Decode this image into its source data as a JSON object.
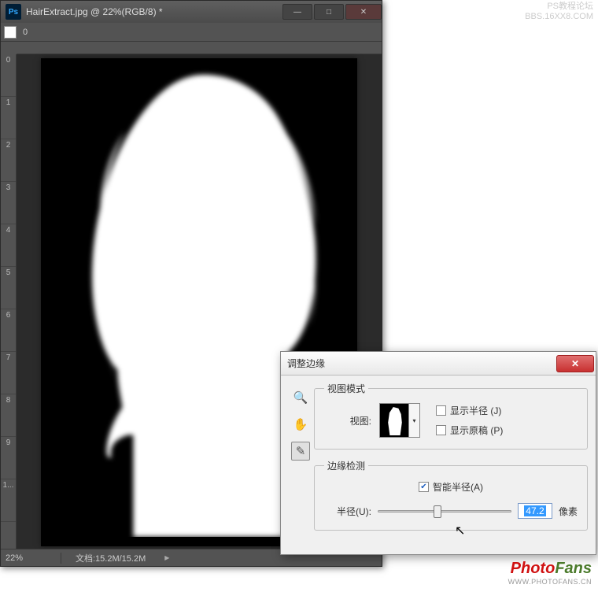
{
  "window": {
    "title": "HairExtract.jpg @ 22%(RGB/8) *",
    "toolbar_opacity": "0",
    "ruler_marks": [
      "0",
      "1",
      "2",
      "3",
      "4",
      "5",
      "6",
      "7",
      "8",
      "9",
      "1..."
    ]
  },
  "statusbar": {
    "zoom": "22%",
    "doc_label": "文档:15.2M/15.2M"
  },
  "dialog": {
    "title": "调整边缘",
    "groups": {
      "view_mode": "视图模式",
      "edge_detect": "边缘检测"
    },
    "view_label": "视图:",
    "show_radius": "显示半径 (J)",
    "show_original": "显示原稿 (P)",
    "smart_radius": "智能半径(A)",
    "radius_label": "半径(U):",
    "radius_value": "47.2",
    "radius_unit": "像素"
  },
  "watermark": {
    "top_line1": "PS教程论坛",
    "top_line2": "BBS.16XX8.COM",
    "logo_photo": "Photo",
    "logo_fans": "Fans",
    "logo_url": "WWW.PHOTOFANS.CN"
  },
  "icons": {
    "ps": "Ps"
  }
}
